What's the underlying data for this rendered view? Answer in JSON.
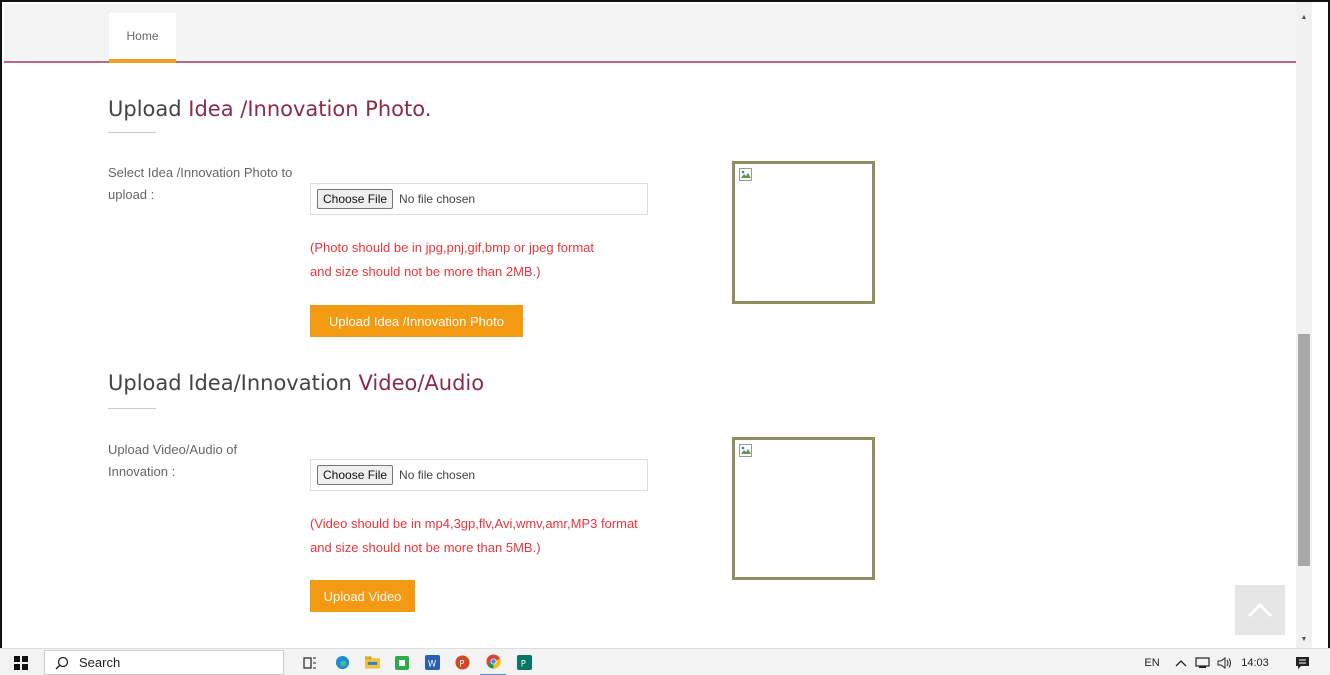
{
  "nav": {
    "home_tab": "Home"
  },
  "photo_section": {
    "title_plain": "Upload ",
    "title_accent": "Idea /Innovation Photo.",
    "label": "Select Idea /Innovation Photo to upload :",
    "choose_label": "Choose File",
    "file_status": "No file chosen",
    "note_line1": "(Photo should be in jpg,pnj,gif,bmp or jpeg format",
    "note_line2": "and size should not be more than 2MB.)",
    "button_label": "Upload Idea /Innovation Photo"
  },
  "video_section": {
    "title_plain": "Upload Idea/Innovation ",
    "title_accent": "Video/Audio",
    "label": "Upload Video/Audio of Innovation :",
    "choose_label": "Choose File",
    "file_status": "No file chosen",
    "note_line1": "(Video should be in mp4,3gp,flv,Avi,wmv,amr,MP3 format",
    "note_line2": "and size should not be more than 5MB.)",
    "button_label": "Upload Video"
  },
  "taskbar": {
    "search_label": "Search",
    "language": "EN",
    "time": "14:03"
  },
  "colors": {
    "accent_text": "#8b2c45",
    "button_orange": "#f39a12",
    "note_red": "#e8363a",
    "preview_border": "#8e8e5e"
  },
  "icons": [
    "windows-start-icon",
    "search-icon",
    "task-view-icon",
    "edge-icon",
    "file-explorer-icon",
    "camtasia-icon",
    "word-icon",
    "powerpoint-icon",
    "chrome-icon",
    "publisher-icon",
    "network-icon",
    "volume-icon",
    "notification-icon",
    "chevron-up-icon"
  ]
}
